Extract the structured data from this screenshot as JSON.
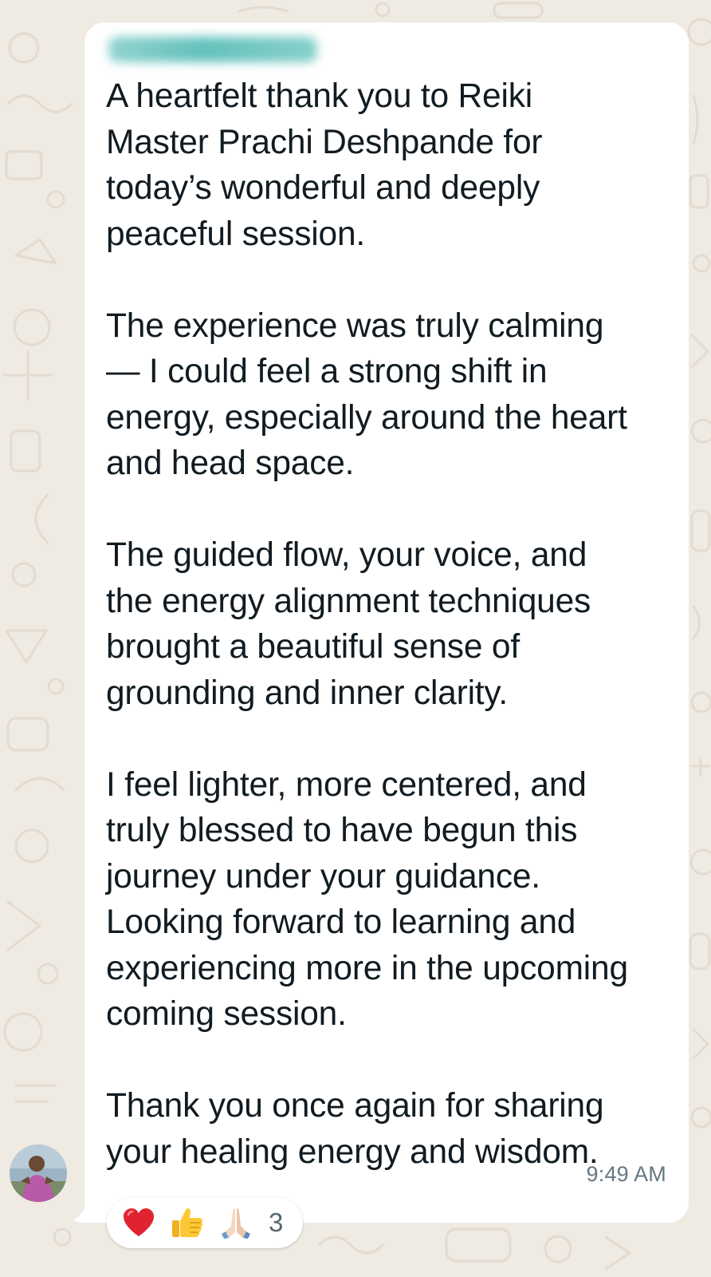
{
  "chat": {
    "sender_name": "",
    "message": {
      "paragraphs": [
        {
          "lines": [
            "A heartfelt thank you to Reiki",
            "Master Prachi Deshpande for",
            "today’s wonderful and deeply",
            "peaceful session."
          ]
        },
        {
          "lines": [
            "The experience was truly calming",
            "— I could feel a strong shift in",
            "energy, especially around the heart",
            "and head space."
          ]
        },
        {
          "lines": [
            "The guided flow, your voice, and",
            "the energy alignment techniques",
            "brought a beautiful sense of",
            "grounding and inner clarity."
          ]
        },
        {
          "lines": [
            "I feel lighter, more centered, and",
            "truly blessed to have begun this",
            "journey under your guidance.",
            "Looking forward to learning and",
            "experiencing more in the upcoming",
            "coming session."
          ]
        },
        {
          "lines": [
            "Thank you once again for sharing",
            "your healing energy and wisdom."
          ]
        }
      ],
      "timestamp": "9:49 AM"
    },
    "reactions": {
      "icons": [
        "red-heart-icon",
        "thumbs-up-icon",
        "folded-hands-icon"
      ],
      "count": "3"
    },
    "colors": {
      "wallpaper": "#efeae2",
      "bubble": "#ffffff",
      "text": "#111b21",
      "timestamp": "#667781",
      "sender_name_blurred": "#63c1bb"
    }
  }
}
